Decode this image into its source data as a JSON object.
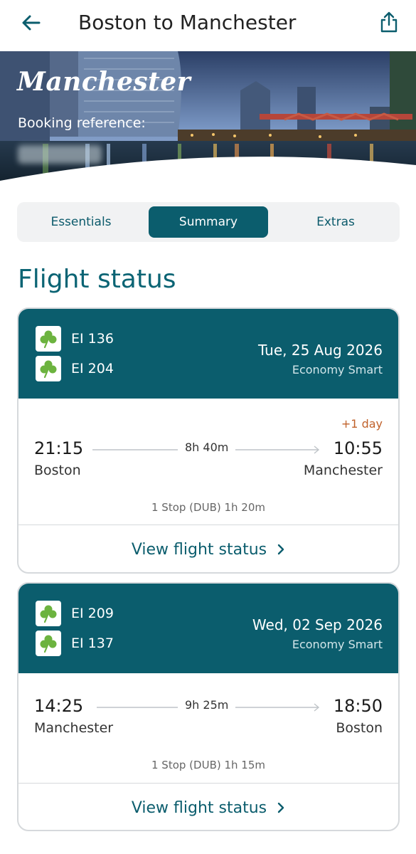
{
  "header": {
    "title": "Boston to Manchester",
    "back_icon": "arrow-left-icon",
    "share_icon": "share-icon"
  },
  "hero": {
    "city": "Manchester",
    "booking_ref_label": "Booking reference:"
  },
  "tabs": [
    {
      "label": "Essentials",
      "active": false
    },
    {
      "label": "Summary",
      "active": true
    },
    {
      "label": "Extras",
      "active": false
    }
  ],
  "section_title": "Flight status",
  "colors": {
    "brand_teal": "#0b5d6d",
    "title_teal": "#0b6474",
    "day_change": "#c0612a",
    "shamrock_green": "#6cb33f"
  },
  "flights": [
    {
      "flight_numbers": [
        "EI 136",
        "EI 204"
      ],
      "date": "Tue, 25 Aug 2026",
      "cabin": "Economy Smart",
      "day_change": "+1 day",
      "depart_time": "21:15",
      "depart_city": "Boston",
      "duration": "8h 40m",
      "arrive_time": "10:55",
      "arrive_city": "Manchester",
      "stops": "1 Stop (DUB) 1h 20m",
      "action": "View flight status"
    },
    {
      "flight_numbers": [
        "EI 209",
        "EI 137"
      ],
      "date": "Wed, 02 Sep 2026",
      "cabin": "Economy Smart",
      "day_change": "",
      "depart_time": "14:25",
      "depart_city": "Manchester",
      "duration": "9h 25m",
      "arrive_time": "18:50",
      "arrive_city": "Boston",
      "stops": "1 Stop (DUB) 1h 15m",
      "action": "View flight status"
    }
  ]
}
